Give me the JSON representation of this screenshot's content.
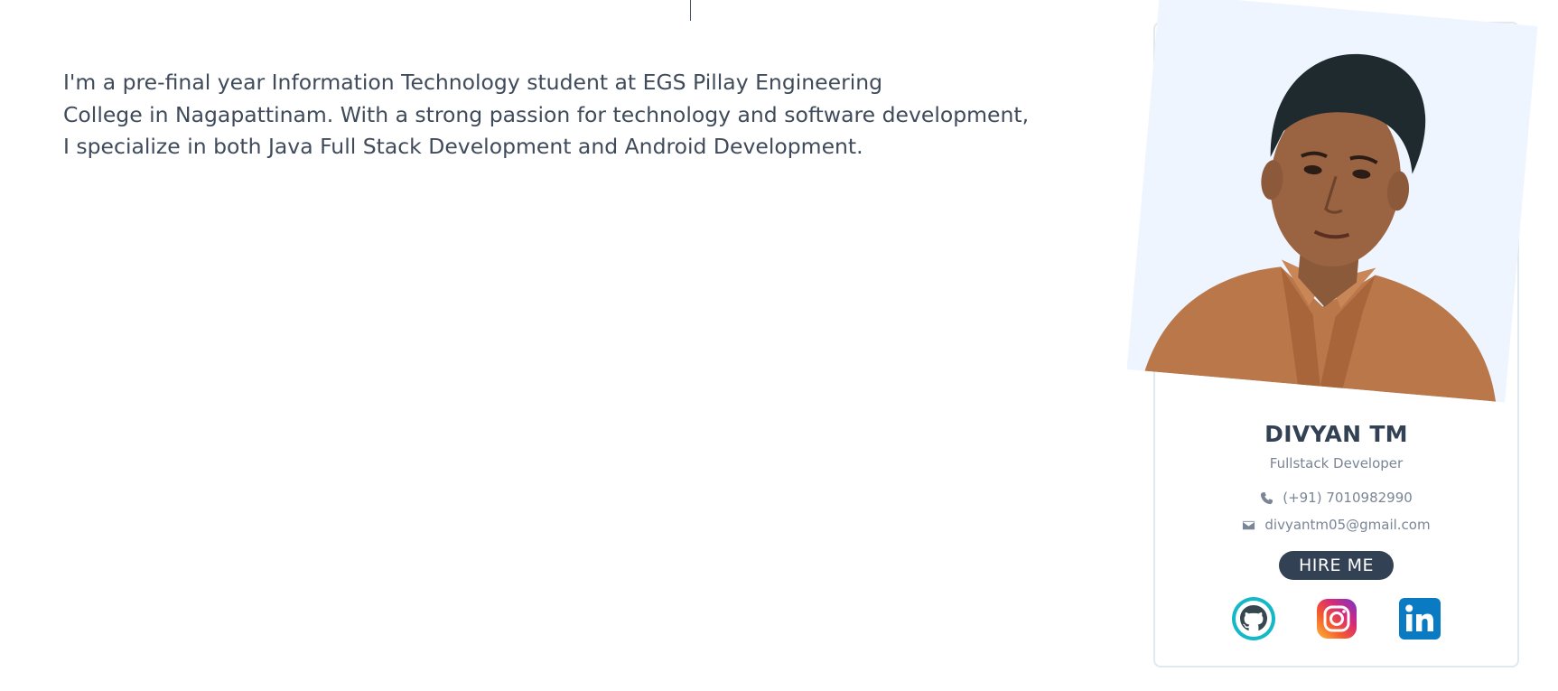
{
  "about": {
    "lines": [
      "I'm a pre-final year Information Technology student at EGS Pillay Engineering",
      "College in Nagapattinam. With a strong passion for technology and software development,",
      "I specialize in both Java Full Stack Development and Android Development."
    ]
  },
  "profile": {
    "name": "DIVYAN TM",
    "role": "Fullstack Developer",
    "phone": "(+91) 7010982990",
    "email": "divyantm05@gmail.com",
    "hire_label": "HIRE ME",
    "photo_icon": "portrait-photo"
  },
  "socials": [
    {
      "name": "github",
      "icon": "github-icon"
    },
    {
      "name": "instagram",
      "icon": "instagram-icon"
    },
    {
      "name": "linkedin",
      "icon": "linkedin-icon"
    }
  ],
  "colors": {
    "accent": "#334155",
    "muted": "#7a8596",
    "photo_bg": "#eef5ff",
    "github_ring": "#14b8c7",
    "linkedin": "#0a7ac2"
  }
}
